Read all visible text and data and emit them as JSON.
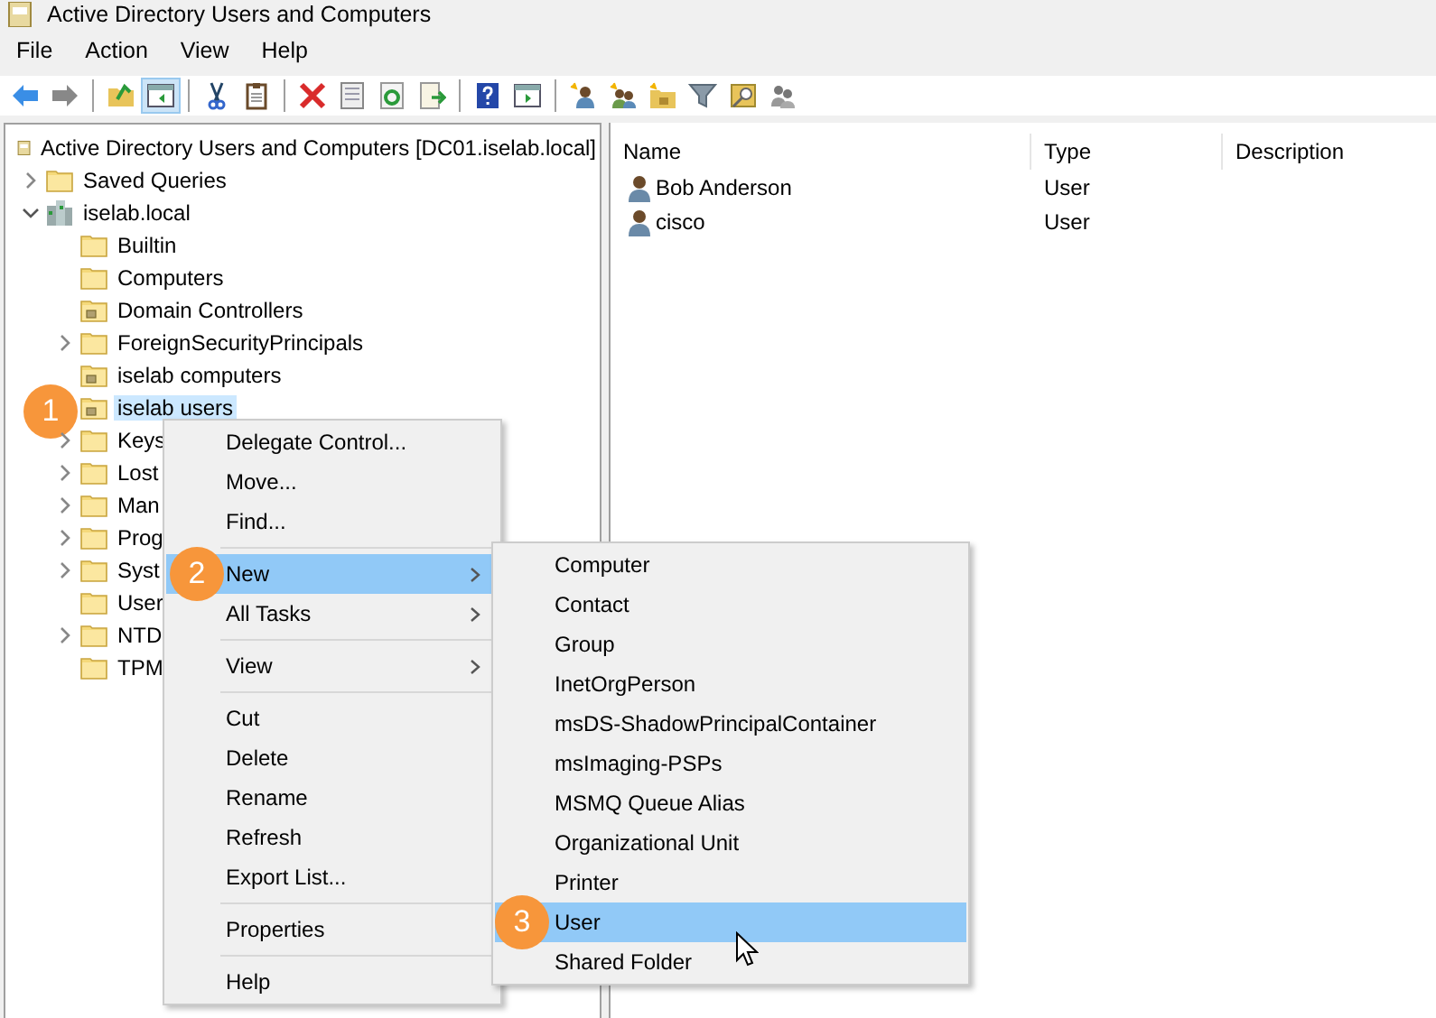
{
  "window": {
    "title": "Active Directory Users and Computers"
  },
  "menu_bar": [
    "File",
    "Action",
    "View",
    "Help"
  ],
  "toolbar": [
    {
      "kind": "back",
      "pressed": false
    },
    {
      "kind": "forward",
      "pressed": false
    },
    {
      "kind": "separator"
    },
    {
      "kind": "up",
      "pressed": false
    },
    {
      "kind": "console-tree",
      "pressed": true
    },
    {
      "kind": "separator"
    },
    {
      "kind": "cut",
      "pressed": false
    },
    {
      "kind": "paste",
      "pressed": false
    },
    {
      "kind": "separator"
    },
    {
      "kind": "delete",
      "pressed": false
    },
    {
      "kind": "properties",
      "pressed": false
    },
    {
      "kind": "refresh",
      "pressed": false
    },
    {
      "kind": "export",
      "pressed": false
    },
    {
      "kind": "separator"
    },
    {
      "kind": "help",
      "pressed": false
    },
    {
      "kind": "action-pane",
      "pressed": false
    },
    {
      "kind": "separator"
    },
    {
      "kind": "new-user",
      "pressed": false
    },
    {
      "kind": "new-group",
      "pressed": false
    },
    {
      "kind": "new-ou",
      "pressed": false
    },
    {
      "kind": "filter",
      "pressed": false
    },
    {
      "kind": "find",
      "pressed": false
    },
    {
      "kind": "add-group",
      "pressed": false
    }
  ],
  "tree": {
    "label": "Active Directory Users and Computers [DC01.iselab.local]",
    "kind": "root",
    "selected": false,
    "children": [
      {
        "label": "Saved Queries",
        "kind": "folder",
        "expanded": false,
        "selected": false
      },
      {
        "label": "iselab.local",
        "kind": "domain",
        "expanded": true,
        "selected": false,
        "children": [
          {
            "label": "Builtin",
            "kind": "folder",
            "selected": false
          },
          {
            "label": "Computers",
            "kind": "folder",
            "selected": false
          },
          {
            "label": "Domain Controllers",
            "kind": "ou",
            "selected": false
          },
          {
            "label": "ForeignSecurityPrincipals",
            "kind": "folder",
            "expanded": false,
            "selected": false
          },
          {
            "label": "iselab computers",
            "kind": "ou",
            "selected": false
          },
          {
            "label": "iselab users",
            "kind": "ou",
            "selected": true,
            "callout": "1"
          },
          {
            "label": "Keys",
            "kind": "folder",
            "expanded": false,
            "selected": false
          },
          {
            "label": "Lost",
            "kind": "folder",
            "expanded": false,
            "selected": false
          },
          {
            "label": "Man",
            "kind": "folder",
            "expanded": false,
            "selected": false
          },
          {
            "label": "Prog",
            "kind": "folder",
            "expanded": false,
            "selected": false
          },
          {
            "label": "Syst",
            "kind": "folder",
            "expanded": false,
            "selected": false
          },
          {
            "label": "User",
            "kind": "folder",
            "selected": false
          },
          {
            "label": "NTD",
            "kind": "folder",
            "expanded": false,
            "selected": false
          },
          {
            "label": "TPM",
            "kind": "folder",
            "selected": false
          }
        ]
      }
    ]
  },
  "list": {
    "columns": [
      "Name",
      "Type",
      "Description"
    ],
    "rows": [
      {
        "name": "Bob Anderson",
        "type": "User"
      },
      {
        "name": "cisco",
        "type": "User"
      }
    ]
  },
  "context_menu": {
    "items": [
      {
        "kind": "item",
        "label": "Delegate Control...",
        "selected": false,
        "submenu": false
      },
      {
        "kind": "item",
        "label": "Move...",
        "selected": false,
        "submenu": false
      },
      {
        "kind": "item",
        "label": "Find...",
        "selected": false,
        "submenu": false
      },
      {
        "kind": "separator"
      },
      {
        "kind": "item",
        "label": "New",
        "selected": true,
        "submenu": true,
        "callout": "2"
      },
      {
        "kind": "item",
        "label": "All Tasks",
        "selected": false,
        "submenu": true
      },
      {
        "kind": "separator"
      },
      {
        "kind": "item",
        "label": "View",
        "selected": false,
        "submenu": true
      },
      {
        "kind": "separator"
      },
      {
        "kind": "item",
        "label": "Cut",
        "selected": false,
        "submenu": false
      },
      {
        "kind": "item",
        "label": "Delete",
        "selected": false,
        "submenu": false
      },
      {
        "kind": "item",
        "label": "Rename",
        "selected": false,
        "submenu": false
      },
      {
        "kind": "item",
        "label": "Refresh",
        "selected": false,
        "submenu": false
      },
      {
        "kind": "item",
        "label": "Export List...",
        "selected": false,
        "submenu": false
      },
      {
        "kind": "separator"
      },
      {
        "kind": "item",
        "label": "Properties",
        "selected": false,
        "submenu": false
      },
      {
        "kind": "separator"
      },
      {
        "kind": "item",
        "label": "Help",
        "selected": false,
        "submenu": false
      }
    ]
  },
  "submenu": {
    "items": [
      {
        "label": "Computer",
        "selected": false
      },
      {
        "label": "Contact",
        "selected": false
      },
      {
        "label": "Group",
        "selected": false
      },
      {
        "label": "InetOrgPerson",
        "selected": false
      },
      {
        "label": "msDS-ShadowPrincipalContainer",
        "selected": false
      },
      {
        "label": "msImaging-PSPs",
        "selected": false
      },
      {
        "label": "MSMQ Queue Alias",
        "selected": false
      },
      {
        "label": "Organizational Unit",
        "selected": false
      },
      {
        "label": "Printer",
        "selected": false
      },
      {
        "label": "User",
        "selected": true,
        "callout": "3"
      },
      {
        "label": "Shared Folder",
        "selected": false
      }
    ]
  }
}
